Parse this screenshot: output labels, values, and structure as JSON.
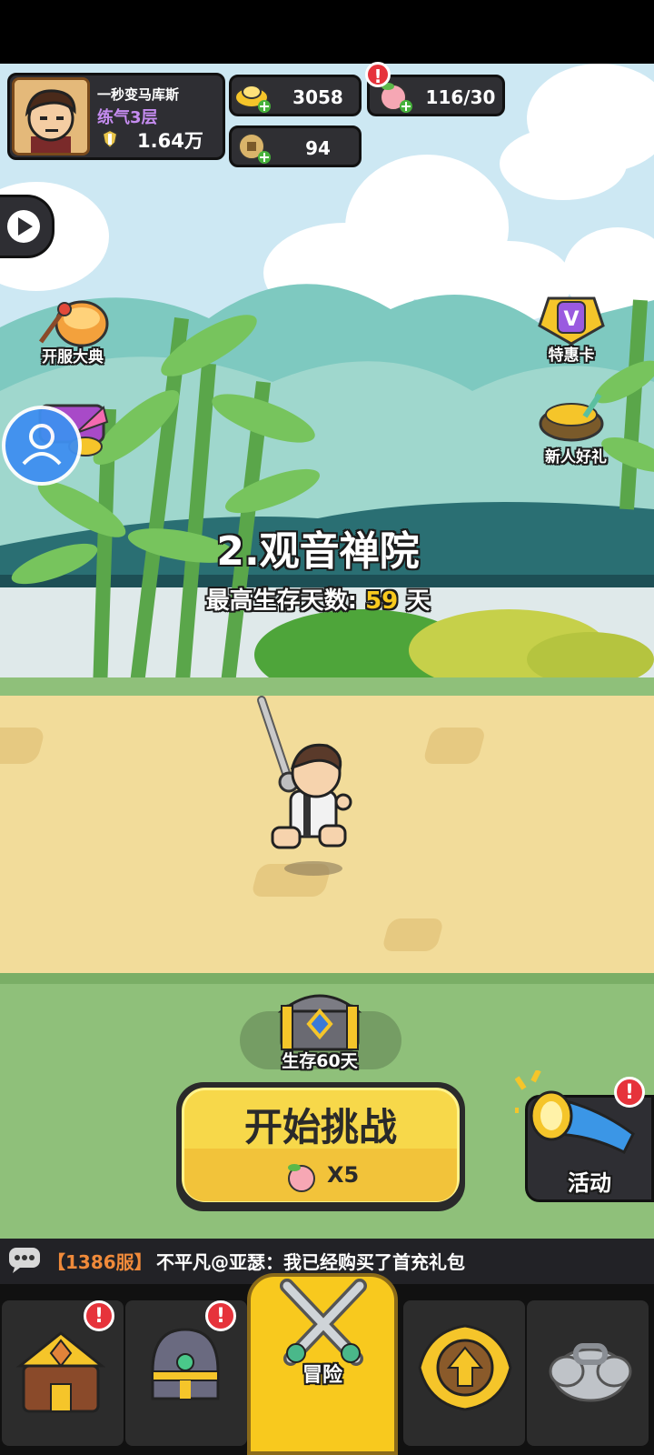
{
  "player": {
    "name": "一秒变马库斯",
    "realm": "练气3层",
    "power": "1.64万"
  },
  "currencies": {
    "gold": "3058",
    "peach": "116/30",
    "coin": "94"
  },
  "side_left": [
    {
      "label": "开服大典"
    }
  ],
  "side_right": [
    {
      "label": "特惠卡"
    },
    {
      "label": "新人好礼"
    }
  ],
  "stage": {
    "title": "2.观音禅院",
    "best_prefix": "最高生存天数:",
    "best_days": "59",
    "best_suffix": "天"
  },
  "chest": {
    "label": "生存60天"
  },
  "start_button": {
    "label": "开始挑战",
    "cost": "X5"
  },
  "activity": {
    "label": "活动"
  },
  "chat": {
    "server": "【1386服】",
    "message": "不平凡@亚瑟：我已经购买了首充礼包"
  },
  "nav": {
    "center_label": "冒险"
  },
  "colors": {
    "sky": "#cfe9f6",
    "sand": "#f2dc9a",
    "grass": "#8fc07a",
    "button_yellow": "#f7d84a",
    "accent_yellow": "#f8c91e",
    "red": "#e6333b"
  }
}
